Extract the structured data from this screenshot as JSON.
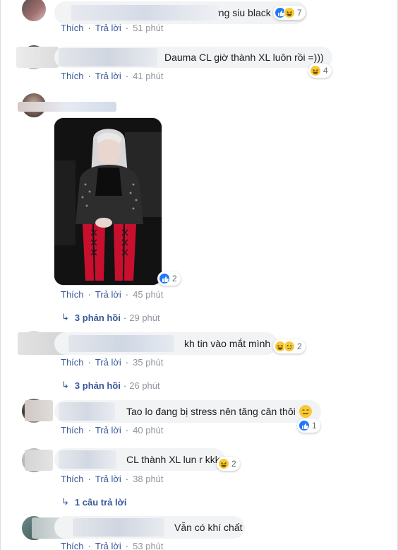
{
  "comments": [
    {
      "text": "Nhìn c tưởng siu black",
      "actions": {
        "like": "Thích",
        "reply": "Trả lời",
        "time": "51 phút"
      },
      "reactions": {
        "icons": [
          "like-icon",
          "haha-icon"
        ],
        "count": "7"
      }
    },
    {
      "text": "Dauma CL giờ thành XL luôn rồi =)))",
      "actions": {
        "like": "Thích",
        "reply": "Trả lời",
        "time": "41 phút"
      },
      "reactions": {
        "icons": [
          "haha-icon"
        ],
        "count": "4"
      }
    },
    {
      "text": "",
      "actions": {
        "like": "Thích",
        "reply": "Trả lời",
        "time": "45 phút"
      },
      "reactions": {
        "icons": [
          "like-icon"
        ],
        "count": "2"
      },
      "replies": {
        "label": "3 phản hồi",
        "time": "29 phút"
      }
    },
    {
      "text": "kh tin vào mắt mình",
      "actions": {
        "like": "Thích",
        "reply": "Trả lời",
        "time": "35 phút"
      },
      "reactions": {
        "icons": [
          "haha-icon",
          "sad-icon"
        ],
        "count": "2"
      },
      "replies": {
        "label": "3 phản hồi",
        "time": "26 phút"
      }
    },
    {
      "text": "Tao lo đang bị stress nên tăng cân thôi",
      "actions": {
        "like": "Thích",
        "reply": "Trả lời",
        "time": "40 phút"
      },
      "reactions": {
        "icons": [
          "like-icon"
        ],
        "count": "1"
      }
    },
    {
      "text": "CL thành XL lun r kkk",
      "actions": {
        "like": "Thích",
        "reply": "Trả lời",
        "time": "38 phút"
      },
      "reactions": {
        "icons": [
          "haha-icon"
        ],
        "count": "2"
      },
      "replies": {
        "label": "1 câu trả lời",
        "time": ""
      }
    },
    {
      "text": "Vẫn có khí chất",
      "actions": {
        "like": "Thích",
        "reply": "Trả lời",
        "time": "53 phút"
      }
    }
  ],
  "colors": {
    "link": "#385898",
    "bubble": "#f2f3f5",
    "like": "#2078f4",
    "haha": "#f7c935"
  }
}
